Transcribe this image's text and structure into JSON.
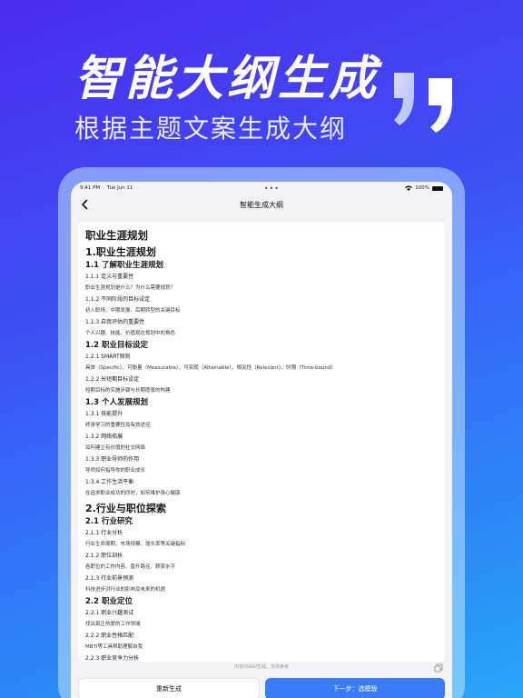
{
  "hero": {
    "title": "智能大纲生成",
    "subtitle": "根据主题文案生成大纲"
  },
  "statusbar": {
    "time": "9:41 PM",
    "date": "Tue Jun 11",
    "dots": "•••",
    "battery": "100%"
  },
  "navbar": {
    "title": "智能生成大纲"
  },
  "outline": [
    {
      "cls": "l-title",
      "text": "职业生涯规划"
    },
    {
      "cls": "l-h1",
      "text": "1.职业生涯规划"
    },
    {
      "cls": "l-h2",
      "text": "1.1 了解职业生涯规划"
    },
    {
      "cls": "l-h4",
      "text": "1.1.1 定义与重要性"
    },
    {
      "cls": "l-p",
      "text": "职业生涯规划是什么？为什么需要规划？"
    },
    {
      "cls": "l-h4",
      "text": "1.1.2 不同阶段的目标设定"
    },
    {
      "cls": "l-p",
      "text": "初入职场、中期发展、后期转型的关键目标"
    },
    {
      "cls": "l-h4",
      "text": "1.1.3 自我评估的重要性"
    },
    {
      "cls": "l-p",
      "text": "个人兴趣、技能、价值观在规划中的角色"
    },
    {
      "cls": "l-h2",
      "text": "1.2 职业目标设定"
    },
    {
      "cls": "l-h4",
      "text": "1.2.1 SMART原则"
    },
    {
      "cls": "l-p",
      "text": "具体（Specific）、可衡量（Measurable）、可实现（Attainable）、相关性（Relevant）、时限（Time-bound）"
    },
    {
      "cls": "l-h4",
      "text": "1.2.2 长短期目标设定"
    },
    {
      "cls": "l-p",
      "text": "短期目标的实施步骤与长期愿景的构建"
    },
    {
      "cls": "l-h2",
      "text": "1.3 个人发展规划"
    },
    {
      "cls": "l-h4",
      "text": "1.3.1 技能提升"
    },
    {
      "cls": "l-p",
      "text": "终身学习的重要性及有效途径"
    },
    {
      "cls": "l-h4",
      "text": "1.3.2 网络拓展"
    },
    {
      "cls": "l-p",
      "text": "如何建立有价值的社交网络"
    },
    {
      "cls": "l-h4",
      "text": "1.3.3 职业导师的作用"
    },
    {
      "cls": "l-p",
      "text": "导师如何指导你的职业成长"
    },
    {
      "cls": "l-h4",
      "text": "1.3.4 工作生活平衡"
    },
    {
      "cls": "l-p",
      "text": "在追求职业成功的同时，如何维护身心健康"
    },
    {
      "cls": "l-h1",
      "text": "2.行业与职位探索"
    },
    {
      "cls": "l-h2",
      "text": "2.1 行业研究"
    },
    {
      "cls": "l-h4",
      "text": "2.1.1 行业分析"
    },
    {
      "cls": "l-p",
      "text": "行业生命周期、市场规模、增长率等关键指标"
    },
    {
      "cls": "l-h4",
      "text": "2.1.2 职位剖析"
    },
    {
      "cls": "l-p",
      "text": "各职位的工作内容、晋升路径、薪资水平"
    },
    {
      "cls": "l-h4",
      "text": "2.1.3 行业前景预测"
    },
    {
      "cls": "l-p",
      "text": "科技进步对行业的影响及未来的机遇"
    },
    {
      "cls": "l-h2",
      "text": "2.2 职业定位"
    },
    {
      "cls": "l-h4",
      "text": "2.2.1 职业兴趣测试"
    },
    {
      "cls": "l-p",
      "text": "找出真正热爱的工作领域"
    },
    {
      "cls": "l-h4",
      "text": "2.2.2 职业性格匹配"
    },
    {
      "cls": "l-p",
      "text": "MBTI等工具帮助理解自我"
    },
    {
      "cls": "l-h4",
      "text": "2.2.3 职业竞争力分析"
    }
  ],
  "footer": {
    "hint": "内容均由AI生成，仅供参考"
  },
  "buttons": {
    "regenerate": "重新生成",
    "next": "下一步：选模版"
  }
}
